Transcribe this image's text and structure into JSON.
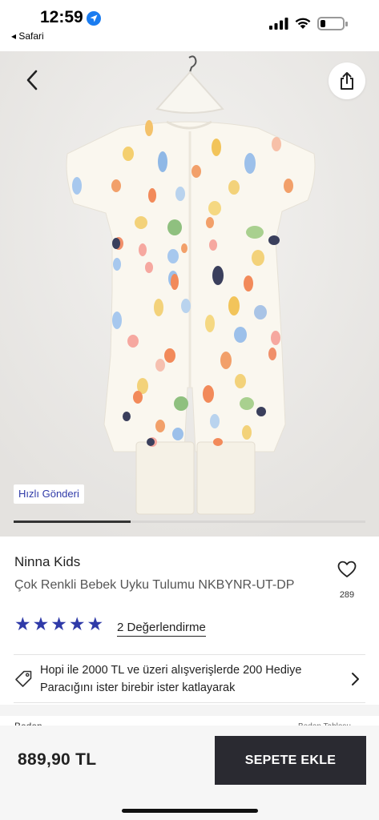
{
  "status_bar": {
    "time": "12:59",
    "back_app": "◂ Safari",
    "location_icon": "location-arrow-icon",
    "signal_icon": "cellular-signal-icon",
    "wifi_icon": "wifi-icon",
    "battery_icon": "battery-low-icon",
    "battery_level": 0.2
  },
  "gallery": {
    "badge": "Hızlı Gönderi",
    "back_icon": "chevron-left-icon",
    "share_icon": "share-icon",
    "progress": 0.333
  },
  "product": {
    "brand": "Ninna Kids",
    "name": "Çok Renkli Bebek Uyku Tulumu NKBYNR-UT-DP",
    "favorite_icon": "heart-icon",
    "favorite_count": "289",
    "rating": 5,
    "stars": [
      "★",
      "★",
      "★",
      "★",
      "★"
    ],
    "reviews_link": "2 Değerlendirme"
  },
  "promo": {
    "icon": "tag-icon",
    "text": "Hopi ile 2000 TL ve üzeri  alışverişlerde 200 Hediye Paracığını ister birebir ister katlayarak",
    "chevron": "chevron-right-icon"
  },
  "peek": {
    "left": "Beden",
    "right": "Beden Tablosu"
  },
  "bottom_bar": {
    "price": "889,90 TL",
    "add_to_cart": "SEPETE EKLE"
  },
  "colors": {
    "accent": "#2f3aa8",
    "button_dark": "#2a2a31",
    "ios_blue": "#1a7cf0"
  }
}
